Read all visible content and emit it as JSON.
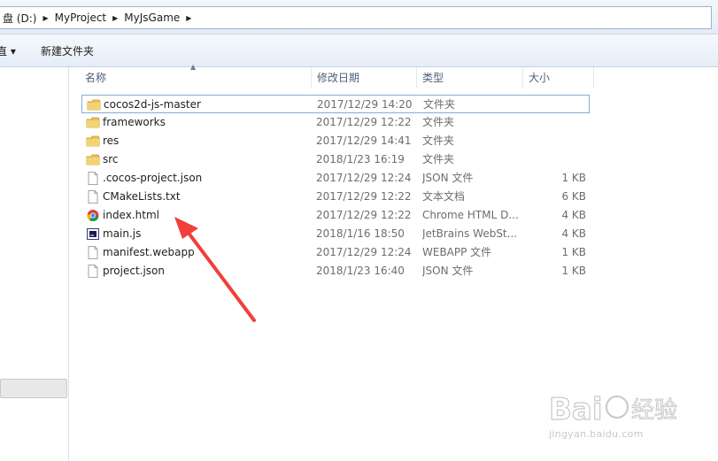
{
  "address": {
    "crumbs": [
      "盘 (D:)",
      "MyProject",
      "MyJsGame"
    ]
  },
  "toolbar": {
    "organize_label": "直 ▾",
    "new_folder_label": "新建文件夹"
  },
  "columns": {
    "name": "名称",
    "date": "修改日期",
    "type": "类型",
    "size": "大小"
  },
  "files": [
    {
      "name": "cocos2d-js-master",
      "date": "2017/12/29 14:20",
      "type": "文件夹",
      "size": "",
      "icon": "folder-icon"
    },
    {
      "name": "frameworks",
      "date": "2017/12/29 12:22",
      "type": "文件夹",
      "size": "",
      "icon": "folder-icon"
    },
    {
      "name": "res",
      "date": "2017/12/29 14:41",
      "type": "文件夹",
      "size": "",
      "icon": "folder-icon"
    },
    {
      "name": "src",
      "date": "2018/1/23 16:19",
      "type": "文件夹",
      "size": "",
      "icon": "folder-icon"
    },
    {
      "name": ".cocos-project.json",
      "date": "2017/12/29 12:24",
      "type": "JSON 文件",
      "size": "1 KB",
      "icon": "file-icon"
    },
    {
      "name": "CMakeLists.txt",
      "date": "2017/12/29 12:22",
      "type": "文本文档",
      "size": "6 KB",
      "icon": "file-icon"
    },
    {
      "name": "index.html",
      "date": "2017/12/29 12:22",
      "type": "Chrome HTML D...",
      "size": "4 KB",
      "icon": "chrome-icon"
    },
    {
      "name": "main.js",
      "date": "2018/1/16 18:50",
      "type": "JetBrains WebSt...",
      "size": "4 KB",
      "icon": "webstorm-file-icon"
    },
    {
      "name": "manifest.webapp",
      "date": "2017/12/29 12:24",
      "type": "WEBAPP 文件",
      "size": "1 KB",
      "icon": "file-icon"
    },
    {
      "name": "project.json",
      "date": "2018/1/23 16:40",
      "type": "JSON 文件",
      "size": "1 KB",
      "icon": "file-icon"
    }
  ],
  "watermark": {
    "brand": "Bai经验",
    "url": "jingyan.baidu.com"
  },
  "colors": {
    "annotation_arrow": "#f0403a",
    "folder": "#e8c15a",
    "selection_border": "#84acdd"
  }
}
